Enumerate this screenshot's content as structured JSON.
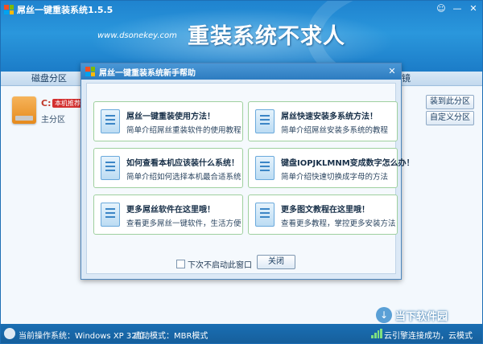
{
  "app": {
    "title": "屌丝一键重装系统1.5.5",
    "site_url": "www.dsonekey.com",
    "slogan": "重装系统不求人",
    "controls": {
      "feedback_icon": "feedback-icon",
      "minimize": "—",
      "close": "✕"
    }
  },
  "tabs": [
    {
      "label": "磁盘分区"
    },
    {
      "label": "镜"
    }
  ],
  "disk": {
    "drive_letter": "C:",
    "badge": "本机推荐",
    "partition_label": "主分区"
  },
  "side_buttons": {
    "install_here": "装到此分区",
    "custom_partition": "自定义分区"
  },
  "dialog": {
    "title": "屌丝一键重装系统新手帮助",
    "close": "✕",
    "cards": [
      {
        "title": "屌丝一键重装使用方法！",
        "desc": "简单介绍屌丝重装软件的使用教程"
      },
      {
        "title": "屌丝快速安装多系统方法！",
        "desc": "简单介绍屌丝安装多系统的教程"
      },
      {
        "title": "如何查看本机应该装什么系统！",
        "desc": "简单介绍如何选择本机最合适系统"
      },
      {
        "title": "键盘IOPJKLMNM变成数字怎么办！",
        "desc": "简单介绍快速切换成字母的方法"
      },
      {
        "title": "更多屌丝软件在这里哦！",
        "desc": "查看更多屌丝一键软件，生活方便"
      },
      {
        "title": "更多图文教程在这里哦！",
        "desc": "查看更多教程，掌控更多安装方法"
      }
    ],
    "checkbox_label": "下次不启动此窗口",
    "close_button": "关闭"
  },
  "status": {
    "os_label": "当前操作系统：Windows XP 32位",
    "boot_mode": "启动模式：MBR模式",
    "cloud_status": "云引擎连接成功，云模式"
  },
  "watermark": {
    "text": "当下软件园",
    "logo_glyph": "↓"
  },
  "colors": {
    "banner": "#1f83cf",
    "status_bar": "#1a6fb4",
    "card_border": "#9fd09f",
    "badge": "#d32f2f"
  }
}
